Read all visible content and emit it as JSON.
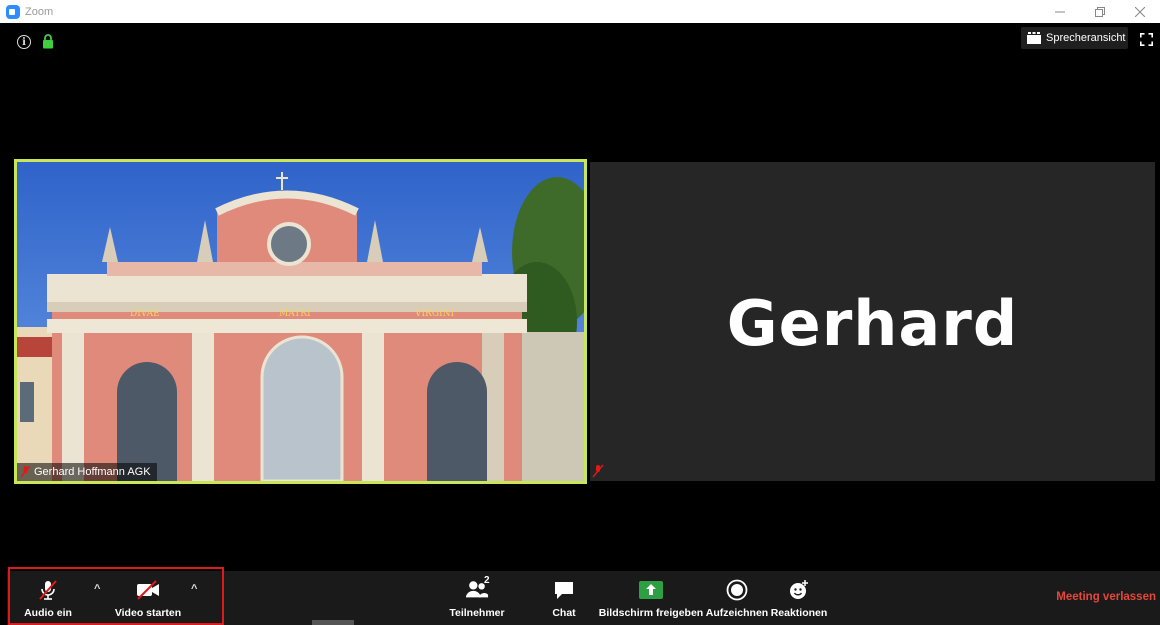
{
  "window": {
    "title": "Zoom",
    "controls": [
      "minimize",
      "restore",
      "close"
    ]
  },
  "top_bar": {
    "icons": [
      "info-icon",
      "lock-icon"
    ],
    "speaker_view_label": "Sprecheransicht",
    "fullscreen_icon": "fullscreen-icon"
  },
  "participants_tiles": {
    "video_tile": {
      "name": "Gerhard Hoffmann AGK",
      "active_speaker_border": "#c8e65a",
      "scene_text": [
        "DIVAE",
        "MATRI",
        "VIRGINI"
      ]
    },
    "name_tile": {
      "display_name": "Gerhard"
    }
  },
  "toolbar": {
    "audio_label": "Audio ein",
    "video_label": "Video starten",
    "participants_label": "Teilnehmer",
    "participants_count": "2",
    "chat_label": "Chat",
    "share_label": "Bildschirm freigeben",
    "record_label": "Aufzeichnen",
    "reactions_label": "Reaktionen",
    "leave_label": "Meeting verlassen",
    "share_color": "#2ea043",
    "leave_color": "#e5473b",
    "highlight_color": "#e0191a"
  }
}
